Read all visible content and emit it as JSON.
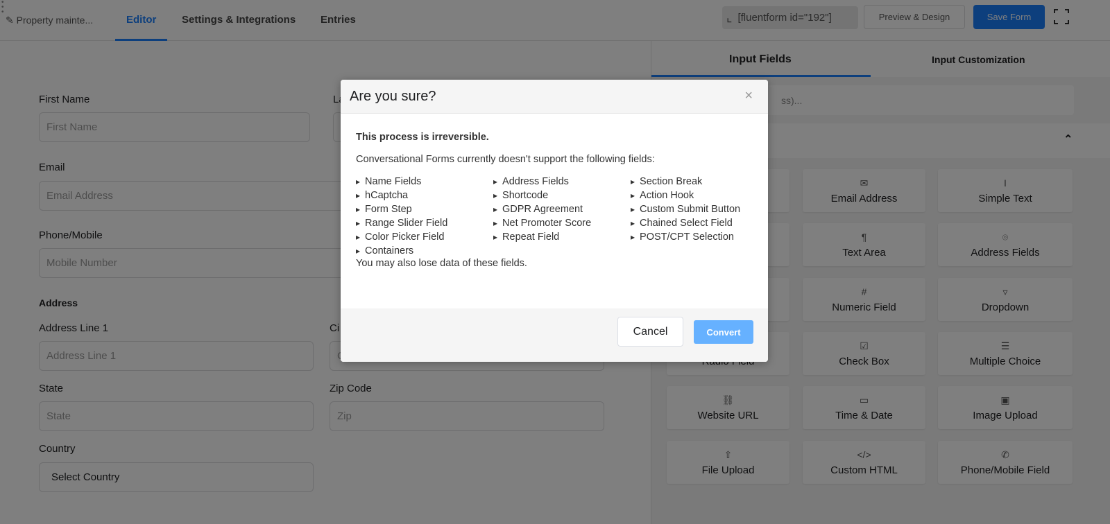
{
  "header": {
    "form_title": "Property mainte...",
    "tabs": [
      "Editor",
      "Settings & Integrations",
      "Entries"
    ],
    "active_tab": "Editor",
    "shortcode": "[fluentform id=\"192\"]",
    "preview_label": "Preview & Design",
    "save_label": "Save Form",
    "accent": "#1a7efb"
  },
  "form": {
    "first_name": {
      "label": "First Name",
      "placeholder": "First Name"
    },
    "last_name": {
      "label": "La"
    },
    "email": {
      "label": "Email",
      "placeholder": "Email Address"
    },
    "phone": {
      "label": "Phone/Mobile",
      "placeholder": "Mobile Number"
    },
    "address_heading": "Address",
    "address_line1": {
      "label": "Address Line 1",
      "placeholder": "Address Line 1"
    },
    "city": {
      "label": "Ci",
      "placeholder": "C"
    },
    "state": {
      "label": "State",
      "placeholder": "State"
    },
    "zip": {
      "label": "Zip Code",
      "placeholder": "Zip"
    },
    "country": {
      "label": "Country",
      "value": "Select Country"
    }
  },
  "panel": {
    "tabs": [
      "Input Fields",
      "Input Customization"
    ],
    "search_placeholder": "ss)...",
    "cards": [
      {
        "label": "",
        "icon": ""
      },
      {
        "label": "Email Address",
        "icon": "envelope"
      },
      {
        "label": "Simple Text",
        "icon": "text-cursor"
      },
      {
        "label": "",
        "icon": ""
      },
      {
        "label": "Text Area",
        "icon": "paragraph"
      },
      {
        "label": "Address Fields",
        "icon": "map-pin"
      },
      {
        "label": "",
        "icon": ""
      },
      {
        "label": "Numeric Field",
        "icon": "hash"
      },
      {
        "label": "Dropdown",
        "icon": "dropdown"
      },
      {
        "label": "Radio Field",
        "icon": ""
      },
      {
        "label": "Check Box",
        "icon": "checkbox"
      },
      {
        "label": "Multiple Choice",
        "icon": "list"
      },
      {
        "label": "Website URL",
        "icon": "link"
      },
      {
        "label": "Time & Date",
        "icon": "calendar"
      },
      {
        "label": "Image Upload",
        "icon": "image"
      },
      {
        "label": "File Upload",
        "icon": "upload"
      },
      {
        "label": "Custom HTML",
        "icon": "code"
      },
      {
        "label": "Phone/Mobile Field",
        "icon": "phone"
      }
    ]
  },
  "modal": {
    "title": "Are you sure?",
    "warning": "This process is irreversible.",
    "intro": "Conversational Forms currently doesn't support the following fields:",
    "fields": [
      "Name Fields",
      "Address Fields",
      "Section Break",
      "hCaptcha",
      "Shortcode",
      "Action Hook",
      "Form Step",
      "GDPR Agreement",
      "Custom Submit Button",
      "Range Slider Field",
      "Net Promoter Score",
      "Chained Select Field",
      "Color Picker Field",
      "Repeat Field",
      "POST/CPT Selection",
      "Containers"
    ],
    "note": "You may also lose data of these fields.",
    "cancel_label": "Cancel",
    "convert_label": "Convert",
    "convert_color": "#66b1ff"
  }
}
